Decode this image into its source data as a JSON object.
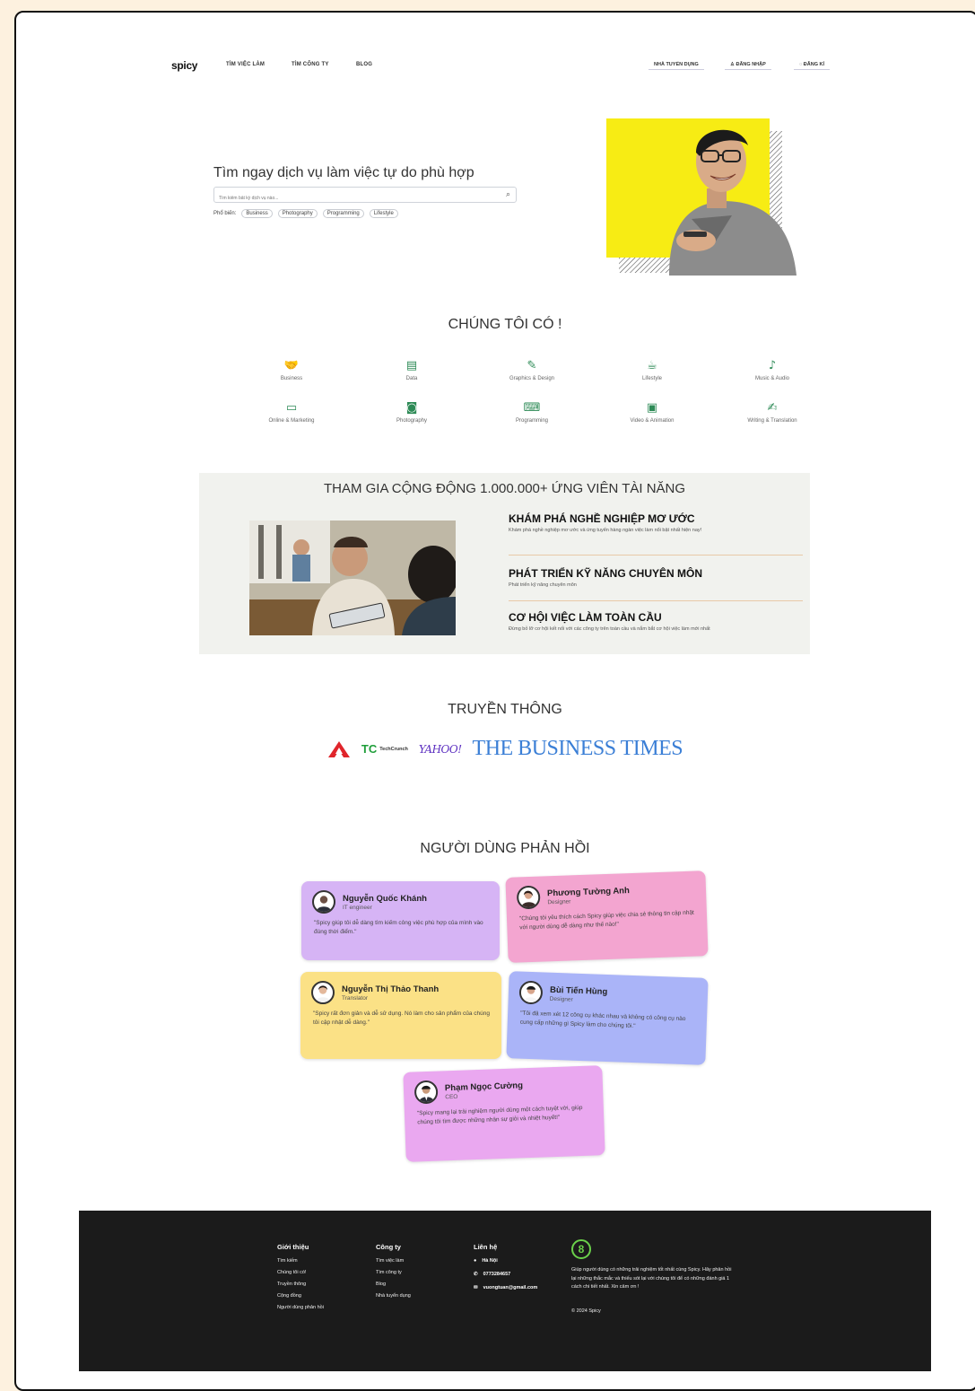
{
  "nav": {
    "logo": "spicy",
    "links": [
      "TÌM VIỆC LÀM",
      "TÌM CÔNG TY",
      "BLOG"
    ],
    "employer": "NHÀ TUYỂN DỤNG",
    "login": "ĐĂNG NHẬP",
    "register": "ĐĂNG KÍ"
  },
  "hero": {
    "title": "Tìm ngay dịch vụ làm việc tự do phù hợp",
    "search_placeholder": "Tìm kiếm bất kỳ dịch vụ nào...",
    "popular_label": "Phổ biến:",
    "tags": [
      "Business",
      "Photography",
      "Programming",
      "Lifestyle"
    ]
  },
  "services": {
    "title": "CHÚNG TÔI CÓ !",
    "items": [
      {
        "label": "Business",
        "icon": "handshake-icon"
      },
      {
        "label": "Data",
        "icon": "data-icon"
      },
      {
        "label": "Graphics & Design",
        "icon": "design-icon"
      },
      {
        "label": "Lifestyle",
        "icon": "coffee-icon"
      },
      {
        "label": "Music & Audio",
        "icon": "microphone-icon"
      },
      {
        "label": "Online & Marketing",
        "icon": "monitor-icon"
      },
      {
        "label": "Photography",
        "icon": "camera-icon"
      },
      {
        "label": "Programming",
        "icon": "code-icon"
      },
      {
        "label": "Video & Animation",
        "icon": "video-icon"
      },
      {
        "label": "Writing & Translation",
        "icon": "document-icon"
      }
    ]
  },
  "community": {
    "title": "THAM GIA CỘNG ĐỘNG 1.000.000+ ỨNG VIÊN TÀI NĂNG",
    "features": [
      {
        "heading": "KHÁM PHÁ NGHỀ NGHIỆP MƠ ƯỚC",
        "desc": "Khám phá nghề nghiệp mơ ước và ứng tuyển hàng ngàn việc làm nổi bật nhất hiện nay!"
      },
      {
        "heading": "PHÁT TRIỂN KỸ NĂNG CHUYÊN MÔN",
        "desc": "Phát triển kỹ năng chuyên môn"
      },
      {
        "heading": "CƠ HỘI VIỆC LÀM TOÀN CẦU",
        "desc": "Đừng bỏ lỡ cơ hội kết nối với các công ty trên toàn cầu và nắm bắt cơ hội việc làm mới nhất"
      }
    ]
  },
  "media": {
    "title": "TRUYỀN THÔNG",
    "techcrunch_mark": "TC",
    "techcrunch": "TechCrunch",
    "yahoo": "YAHOO!",
    "business_times": "THE BUSINESS TIMES"
  },
  "feedback": {
    "title": "NGƯỜI DÙNG PHẢN HỒI",
    "cards": [
      {
        "name": "Nguyễn Quốc Khánh",
        "role": "IT engineer",
        "quote": "\"Spicy giúp tôi dễ dàng tìm kiếm công việc phù hợp của mình vào đúng thời điểm.\"",
        "color": "#d6b4f5"
      },
      {
        "name": "Phương Tường Anh",
        "role": "Designer",
        "quote": "\"Chúng tôi yêu thích cách Spicy giúp việc chia sẻ thông tin cập nhật với người dùng dễ dàng như thế nào!\"",
        "color": "#f3a5d0"
      },
      {
        "name": "Nguyễn Thị Thảo Thanh",
        "role": "Translator",
        "quote": "\"Spicy rất đơn giản và dễ sử dụng. Nó làm cho sản phẩm của chúng tôi cập nhật dễ dàng.\"",
        "color": "#fbe186"
      },
      {
        "name": "Bùi Tiến Hùng",
        "role": "Designer",
        "quote": "\"Tôi đã xem xét 12 công cụ khác nhau và không có công cụ nào cung cấp những gì Spicy làm cho chúng tôi.\"",
        "color": "#aab4f8"
      },
      {
        "name": "Phạm Ngọc Cường",
        "role": "CEO",
        "quote": "\"Spicy mang lại trải nghiệm người dùng một cách tuyệt vời, giúp chúng tôi tìm được những nhân sự giỏi và nhiệt huyết!\"",
        "color": "#eaa8f0"
      }
    ]
  },
  "footer": {
    "intro": {
      "title": "Giới thiệu",
      "items": [
        "Tìm kiếm",
        "Chúng tôi có!",
        "Truyền thông",
        "Cộng đồng",
        "Người dùng phản hồi"
      ]
    },
    "company": {
      "title": "Công ty",
      "items": [
        "Tìm việc làm",
        "Tìm công ty",
        "Blog",
        "Nhà tuyển dụng"
      ]
    },
    "contact": {
      "title": "Liên hệ",
      "location": "Hà Nội",
      "phone": "0773284657",
      "email": "vuongtuan@gmail.com"
    },
    "logo": "8",
    "desc": "Giúp người dùng có những trải nghiệm tốt nhất cùng Spicy. Hãy phản hồi lại những thắc mắc và thiếu sót lại với chúng tôi để có những đánh giá 1 cách chi tiết nhất. Xin cảm ơn !",
    "copyright": "© 2024 Spicy"
  }
}
